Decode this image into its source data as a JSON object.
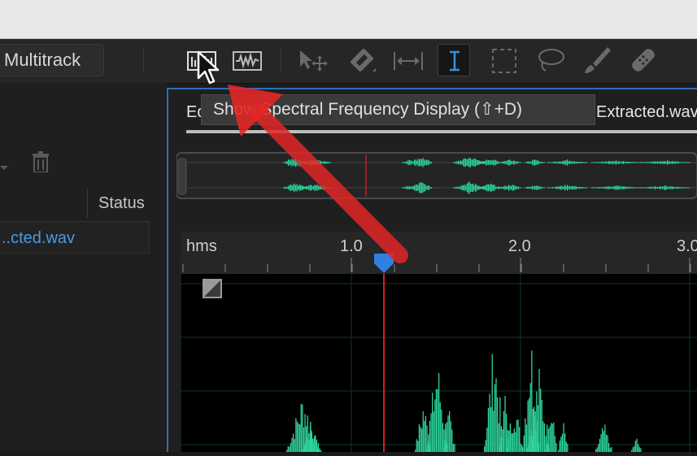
{
  "toolbar": {
    "multitrack_label": "Multitrack",
    "tools": [
      {
        "name": "spectral-frequency-display",
        "icon": "spectral-icon"
      },
      {
        "name": "waveform-display",
        "icon": "waveform-icon"
      },
      {
        "name": "move-tool",
        "icon": "move-icon"
      },
      {
        "name": "razor-tool",
        "icon": "razor-icon"
      },
      {
        "name": "slip-tool",
        "icon": "slip-icon"
      },
      {
        "name": "time-selection-tool",
        "icon": "time-selection-icon"
      },
      {
        "name": "marquee-tool",
        "icon": "marquee-icon"
      },
      {
        "name": "lasso-tool",
        "icon": "lasso-icon"
      },
      {
        "name": "brush-tool",
        "icon": "brush-icon"
      },
      {
        "name": "spot-healing-tool",
        "icon": "spot-healing-icon"
      }
    ]
  },
  "tooltip": {
    "text": "Show Spectral Frequency Display (⇧+D)"
  },
  "files_panel": {
    "status_header": "Status",
    "selected_file": "..cted.wav"
  },
  "editor": {
    "tab_partial": "Ed",
    "tab_name": "Extracted.wav",
    "ruler": {
      "unit": "hms",
      "ticks": [
        "1.0",
        "2.0",
        "3.0"
      ]
    },
    "playhead_seconds": 1.2
  },
  "colors": {
    "waveform": "#2ed39a",
    "playhead": "#d61f1f",
    "annotation_arrow": "#e32626",
    "accent": "#4a9be0"
  }
}
